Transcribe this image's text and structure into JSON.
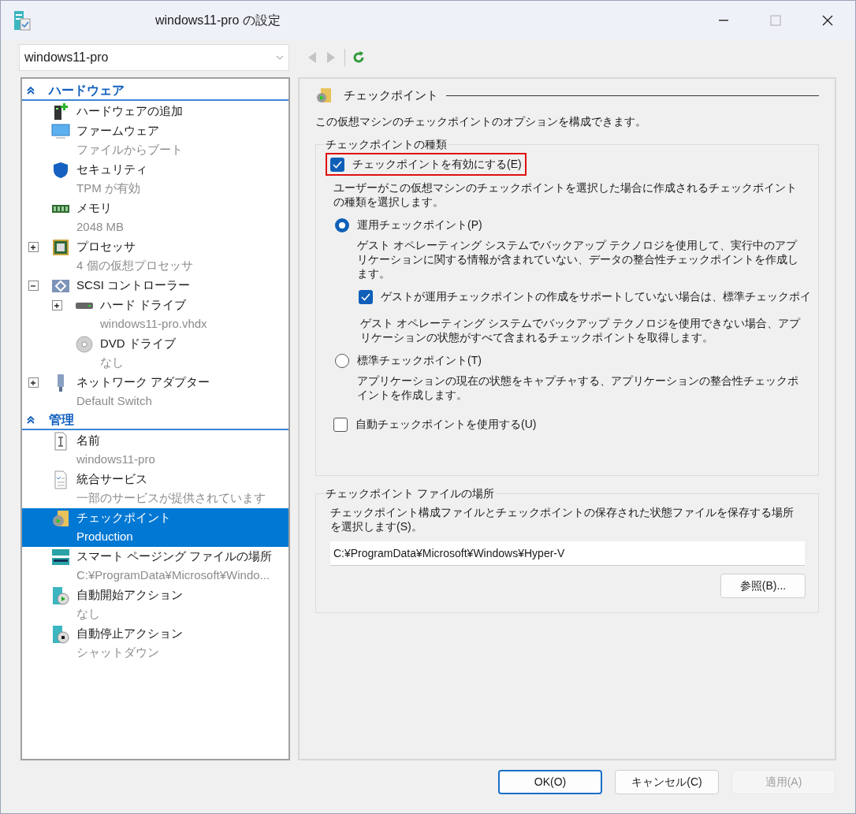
{
  "window": {
    "title": "windows11-pro の設定",
    "maximize_disabled": true
  },
  "vm_selector": {
    "value": "windows11-pro"
  },
  "toolbar": {
    "back_disabled": true,
    "forward_disabled": true
  },
  "sidebar": {
    "sections": [
      {
        "title": "ハードウェア",
        "expanded": true,
        "items": [
          {
            "label": "ハードウェアの追加",
            "kind": "addhardware",
            "selected": false
          },
          {
            "label": "ファームウェア",
            "detail": "ファイルからブート",
            "kind": "firmware",
            "selected": false
          },
          {
            "label": "セキュリティ",
            "detail": "TPM が有効",
            "kind": "security",
            "selected": false
          },
          {
            "label": "メモリ",
            "detail": "2048 MB",
            "kind": "memory",
            "selected": false
          },
          {
            "label": "プロセッサ",
            "detail": "4 個の仮想プロセッサ",
            "kind": "processor",
            "expanded": false,
            "selected": false
          },
          {
            "label": "SCSI コントローラー",
            "kind": "controller",
            "expanded": true,
            "selected": false,
            "children": [
              {
                "label": "ハード ドライブ",
                "detail": "windows11-pro.vhdx",
                "kind": "disk",
                "expanded": false,
                "selected": false
              },
              {
                "label": "DVD ドライブ",
                "detail": "なし",
                "kind": "dvd",
                "selected": false
              }
            ]
          },
          {
            "label": "ネットワーク アダプター",
            "detail": "Default Switch",
            "kind": "network",
            "expanded": false,
            "selected": false
          }
        ]
      },
      {
        "title": "管理",
        "expanded": true,
        "items": [
          {
            "label": "名前",
            "detail": "windows11-pro",
            "kind": "name",
            "selected": false
          },
          {
            "label": "統合サービス",
            "detail": "一部のサービスが提供されています",
            "kind": "services",
            "selected": false
          },
          {
            "label": "チェックポイント",
            "detail": "Production",
            "kind": "checkpoint",
            "selected": true
          },
          {
            "label": "スマート ページング ファイルの場所",
            "detail": "C:¥ProgramData¥Microsoft¥Windo...",
            "kind": "paging",
            "selected": false
          },
          {
            "label": "自動開始アクション",
            "detail": "なし",
            "kind": "autostart",
            "selected": false
          },
          {
            "label": "自動停止アクション",
            "detail": "シャットダウン",
            "kind": "autostop",
            "selected": false
          }
        ]
      }
    ]
  },
  "panel": {
    "title": "チェックポイント",
    "intro": "この仮想マシンのチェックポイントのオプションを構成できます。",
    "type_group": {
      "legend": "チェックポイントの種類",
      "enable": {
        "label": "チェックポイントを有効にする(E)",
        "checked": true,
        "highlighted": true
      },
      "description": "ユーザーがこの仮想マシンのチェックポイントを選択した場合に作成されるチェックポイントの種類を選択します。",
      "options": [
        {
          "label": "運用チェックポイント(P)",
          "selected": true,
          "description": "ゲスト オペレーティング システムでバックアップ テクノロジを使用して、実行中のアプリケーションに関する情報が含まれていない、データの整合性チェックポイントを作成します。",
          "fallback": {
            "label": "ゲストが運用チェックポイントの作成をサポートしていない場合は、標準チェックポイ",
            "checked": true,
            "description": "ゲスト オペレーティング システムでバックアップ テクノロジを使用できない場合、アプリケーションの状態がすべて含まれるチェックポイントを取得します。"
          }
        },
        {
          "label": "標準チェックポイント(T)",
          "selected": false,
          "description": "アプリケーションの現在の状態をキャプチャする、アプリケーションの整合性チェックポイントを作成します。"
        }
      ],
      "automatic": {
        "label": "自動チェックポイントを使用する(U)",
        "checked": false
      }
    },
    "location_group": {
      "legend": "チェックポイント ファイルの場所",
      "description": "チェックポイント構成ファイルとチェックポイントの保存された状態ファイルを保存する場所を選択します(S)。",
      "path": "C:¥ProgramData¥Microsoft¥Windows¥Hyper-V",
      "browse": "参照(B)..."
    }
  },
  "buttons": [
    {
      "label": "OK(O)",
      "default": true,
      "disabled": false
    },
    {
      "label": "キャンセル(C)",
      "default": false,
      "disabled": false
    },
    {
      "label": "適用(A)",
      "default": false,
      "disabled": true
    }
  ]
}
